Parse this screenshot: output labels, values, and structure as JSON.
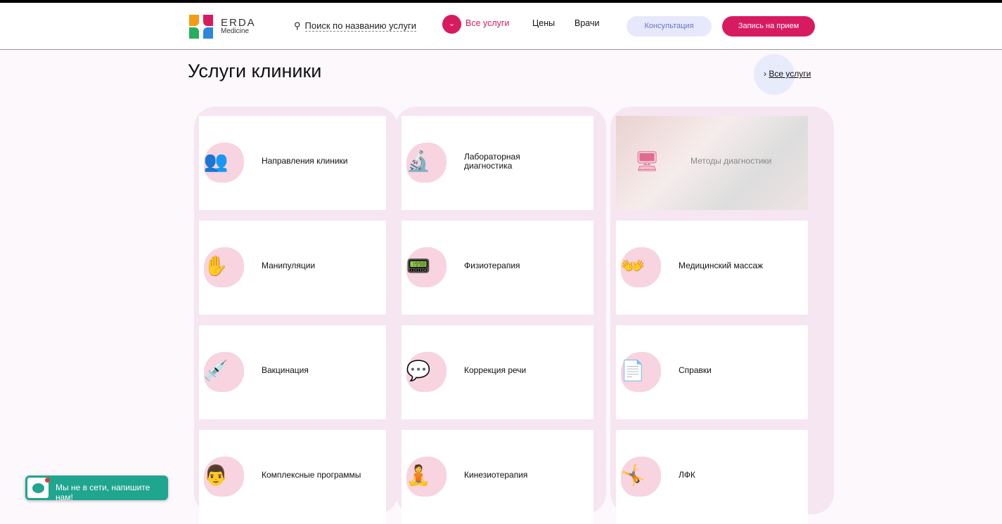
{
  "header": {
    "brand": "ERDA",
    "brand_sub": "Medicine",
    "search_placeholder": "Поиск по названию услуги",
    "nav": [
      "Все услуги",
      "Цены",
      "Врачи"
    ],
    "consult_button": "Консультация",
    "appointment_button": "Запись на прием"
  },
  "page_title": "Услуги клиники",
  "all_services_link": "Все услуги",
  "services": [
    {
      "label": "Направления клиники",
      "icon": "doctors-icon"
    },
    {
      "label": "Лабораторная диагностика",
      "icon": "microscope-icon"
    },
    {
      "label": "Методы диагностики",
      "icon": "monitor-icon"
    },
    {
      "label": "Манипуляции",
      "icon": "hand-icon"
    },
    {
      "label": "Физиотерапия",
      "icon": "device-icon"
    },
    {
      "label": "Медицинский массаж",
      "icon": "massage-icon"
    },
    {
      "label": "Вакцинация",
      "icon": "syringe-icon"
    },
    {
      "label": "Коррекция речи",
      "icon": "speech-icon"
    },
    {
      "label": "Справки",
      "icon": "certificate-icon"
    },
    {
      "label": "Комплексные программы",
      "icon": "doctor-icon"
    },
    {
      "label": "Кинезиотерапия",
      "icon": "kinesio-icon"
    },
    {
      "label": "ЛФК",
      "icon": "yoga-icon"
    }
  ],
  "chat": {
    "text": "Мы не в сети, напишите нам!"
  },
  "colors": {
    "accent": "#d81b60",
    "consult_bg": "#e6e9fb",
    "chat": "#20a58f"
  }
}
